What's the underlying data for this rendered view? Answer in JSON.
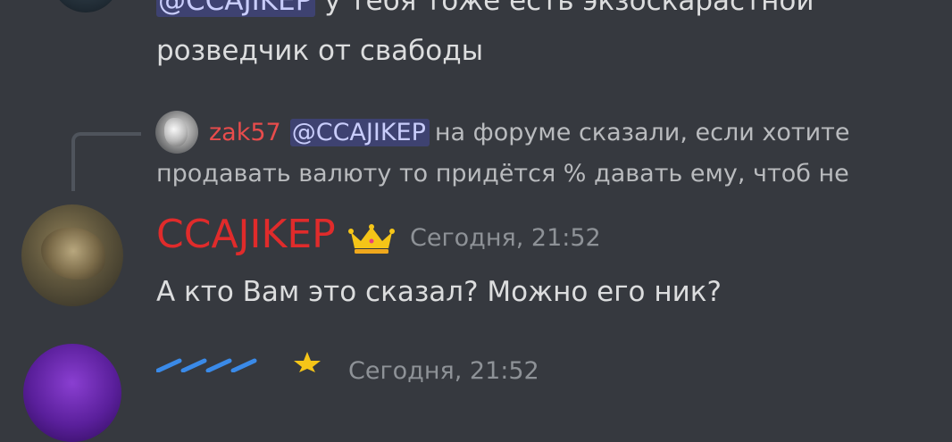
{
  "previous_message": {
    "mention": "@CCAJIKEP",
    "line1_text": "у тебя тоже есть экзоскарастной",
    "line2_text": "розведчик от свабоды"
  },
  "reply_reference": {
    "author": "zak57",
    "mention": "@CCAJIKEP",
    "line1_text": "на форуме сказали, если хотите",
    "line2_text": "продавать валюту то придётся % давать ему, чтоб не"
  },
  "message": {
    "author": "CCAJIKEP",
    "author_color": "#e02b2b",
    "badge_icon": "crown-icon",
    "timestamp": "Сегодня, 21:52",
    "text": "А кто Вам это сказал? Можно его ник?"
  },
  "next_message": {
    "badge_icon": "star-icon",
    "timestamp": "Сегодня, 21:52"
  },
  "colors": {
    "background": "#36393f",
    "mention_bg": "#3e4271",
    "reply_author": "#e84c4c",
    "text": "#dcddde",
    "muted": "#8e9297"
  }
}
